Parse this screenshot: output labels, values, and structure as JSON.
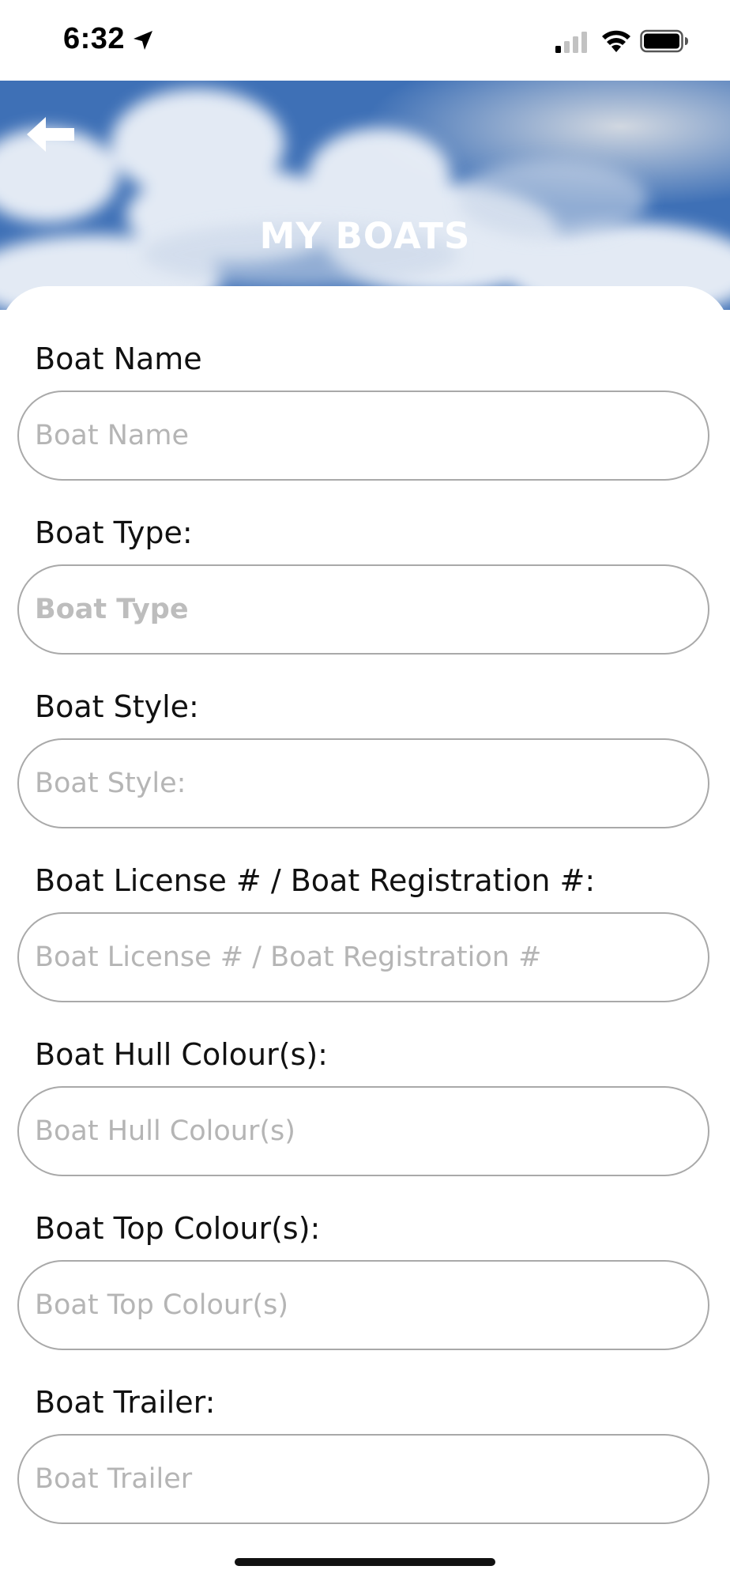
{
  "status_bar": {
    "time": "6:32",
    "icons": [
      "location-arrow-icon",
      "cellular-signal-icon",
      "wifi-icon",
      "battery-icon"
    ]
  },
  "header": {
    "title": "MY BOATS",
    "back_icon": "back-arrow-icon"
  },
  "form": {
    "fields": [
      {
        "label": "Boat Name",
        "placeholder": "Boat Name",
        "value": ""
      },
      {
        "label": "Boat Type:",
        "placeholder": "Boat Type",
        "value": ""
      },
      {
        "label": "Boat Style:",
        "placeholder": "Boat Style:",
        "value": ""
      },
      {
        "label": "Boat License # / Boat Registration #:",
        "placeholder": "Boat License # / Boat Registration #",
        "value": ""
      },
      {
        "label": "Boat Hull Colour(s):",
        "placeholder": "Boat Hull Colour(s)",
        "value": ""
      },
      {
        "label": "Boat Top Colour(s):",
        "placeholder": "Boat Top Colour(s)",
        "value": ""
      },
      {
        "label": "Boat Trailer:",
        "placeholder": "Boat Trailer",
        "value": ""
      }
    ]
  },
  "colors": {
    "header_sky": "#4a7fc0",
    "input_border": "#a9a9a9",
    "placeholder": "#b5b5b5",
    "label_text": "#111111"
  }
}
